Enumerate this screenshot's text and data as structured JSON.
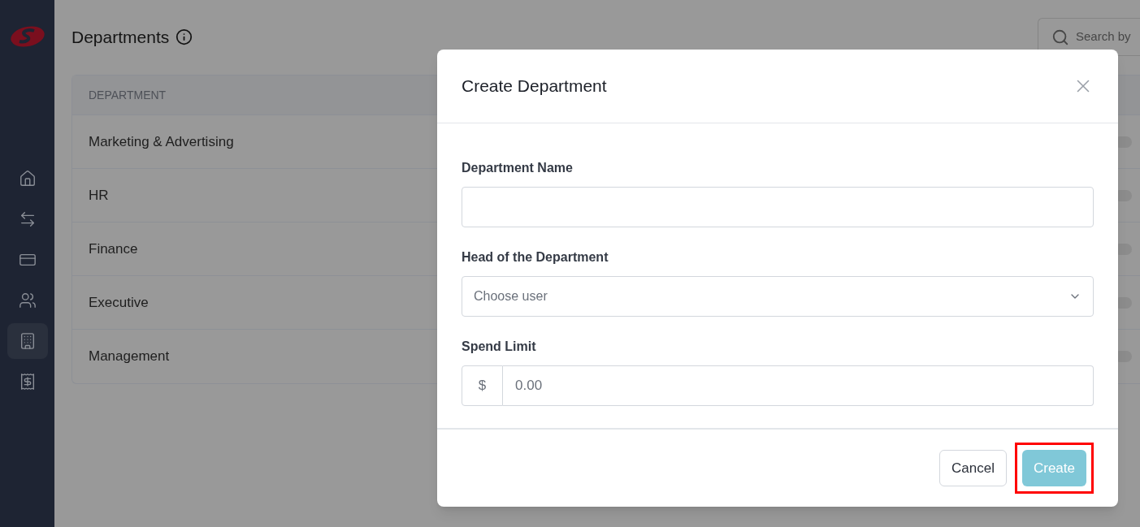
{
  "sidebar": {
    "items": [
      {
        "selected": false
      },
      {
        "selected": false
      },
      {
        "selected": false
      },
      {
        "selected": false
      },
      {
        "selected": true
      },
      {
        "selected": false
      }
    ]
  },
  "page": {
    "title": "Departments",
    "search": {
      "placeholder": "Search by"
    }
  },
  "table": {
    "columns": [
      "DEPARTMENT"
    ],
    "rows": [
      {
        "name": "Marketing & Advertising"
      },
      {
        "name": "HR"
      },
      {
        "name": "Finance"
      },
      {
        "name": "Executive"
      },
      {
        "name": "Management"
      }
    ]
  },
  "dialog": {
    "title": "Create Department",
    "fields": [
      {
        "kind": "text",
        "label": "Department Name"
      },
      {
        "kind": "select",
        "label": "Head of the Department",
        "placeholder": "Choose user"
      },
      {
        "kind": "money",
        "label": "Spend Limit",
        "prefix": "$",
        "placeholder": "0.00"
      }
    ],
    "buttons": [
      {
        "label": "Cancel",
        "primary": false,
        "disabled": false,
        "highlighted": false
      },
      {
        "label": "Create",
        "primary": true,
        "disabled": true,
        "highlighted": true
      }
    ]
  }
}
